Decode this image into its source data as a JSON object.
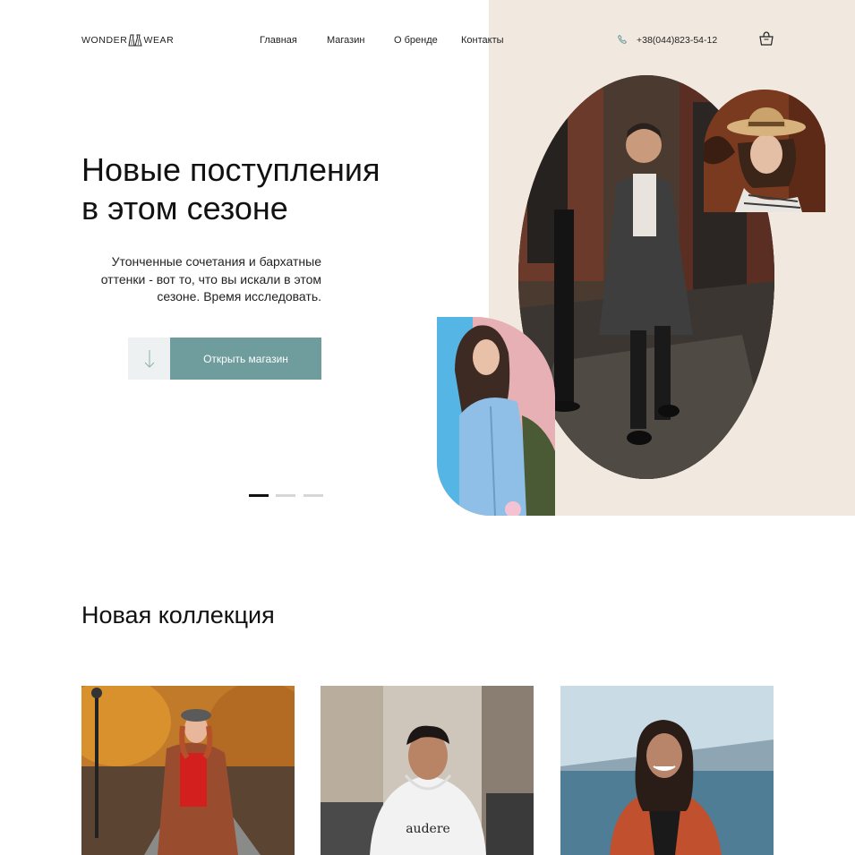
{
  "header": {
    "logo_left": "WONDER",
    "logo_right": "WEAR",
    "nav": [
      "Главная",
      "Магазин",
      "О бренде",
      "Контакты"
    ],
    "phone": "+38(044)823-54-12"
  },
  "hero": {
    "title_line1": "Новые поступления",
    "title_line2": "в этом сезоне",
    "text": "Утонченные сочетания и бархатные оттенки - вот то, что вы искали в этом сезоне. Время исследовать.",
    "button_label": "Открыть магазин",
    "slider_active_index": 0,
    "slider_count": 3
  },
  "collection": {
    "title": "Новая коллекция",
    "sweatshirt_print": "audere"
  },
  "colors": {
    "accent": "#6f9c9c",
    "hero_background": "#f1e9df",
    "text": "#111111"
  }
}
